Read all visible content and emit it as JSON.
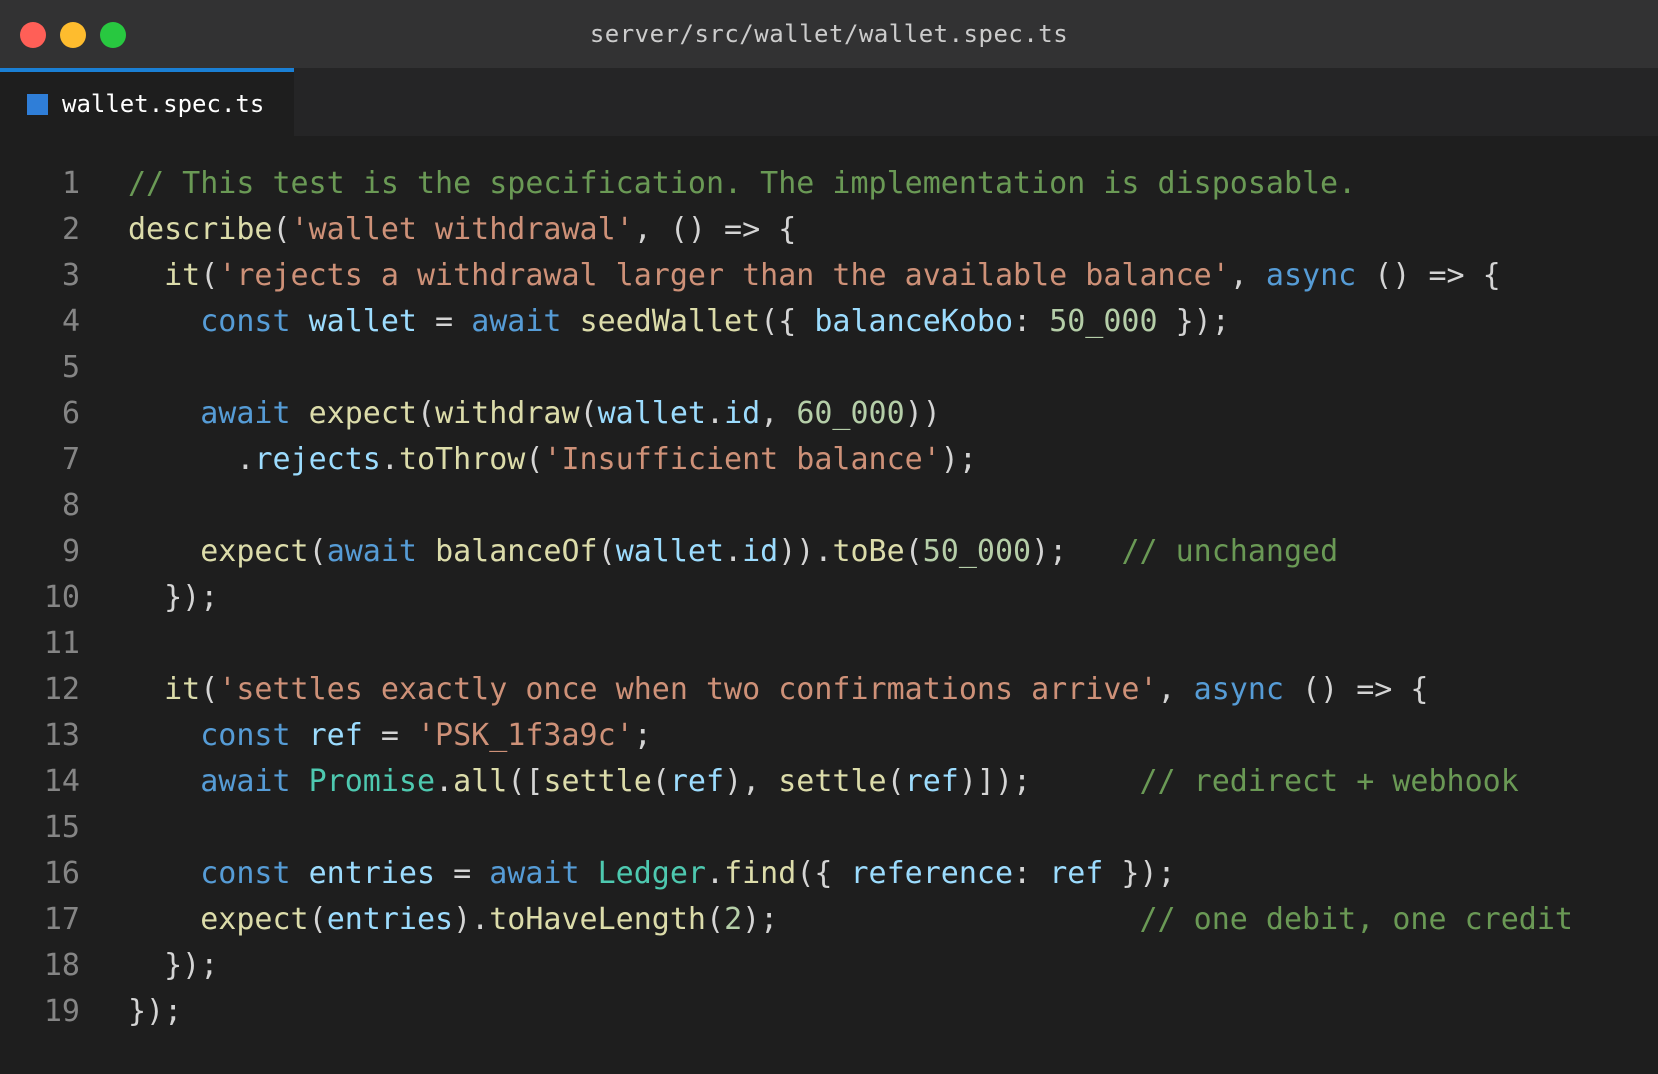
{
  "window": {
    "title": "server/src/wallet/wallet.spec.ts",
    "traffic_lights": [
      {
        "name": "close",
        "color": "#ff5f57"
      },
      {
        "name": "minimize",
        "color": "#febc2e"
      },
      {
        "name": "maximize",
        "color": "#28c840"
      }
    ]
  },
  "tabs": [
    {
      "label": "wallet.spec.ts",
      "icon": "typescript-file-icon",
      "active": true
    }
  ],
  "theme": {
    "comment": "#6a9955",
    "string": "#ce9178",
    "keyword": "#569cd6",
    "function": "#dcdcaa",
    "variable": "#9cdcfe",
    "number": "#b5cea8",
    "type": "#4ec9b0"
  },
  "code_lines": [
    {
      "n": "1",
      "tokens": [
        {
          "t": "// This test is the specification. The implementation is disposable.",
          "k": "comment"
        }
      ]
    },
    {
      "n": "2",
      "tokens": [
        {
          "t": "describe",
          "k": "func"
        },
        {
          "t": "(",
          "k": "punct"
        },
        {
          "t": "'wallet withdrawal'",
          "k": "string"
        },
        {
          "t": ", () => {",
          "k": "punct"
        }
      ]
    },
    {
      "n": "3",
      "tokens": [
        {
          "t": "  ",
          "k": "punct"
        },
        {
          "t": "it",
          "k": "func"
        },
        {
          "t": "(",
          "k": "punct"
        },
        {
          "t": "'rejects a withdrawal larger than the available balance'",
          "k": "string"
        },
        {
          "t": ", ",
          "k": "punct"
        },
        {
          "t": "async",
          "k": "keyword"
        },
        {
          "t": " () => {",
          "k": "punct"
        }
      ]
    },
    {
      "n": "4",
      "tokens": [
        {
          "t": "    ",
          "k": "punct"
        },
        {
          "t": "const",
          "k": "keyword"
        },
        {
          "t": " ",
          "k": "punct"
        },
        {
          "t": "wallet",
          "k": "var"
        },
        {
          "t": " = ",
          "k": "punct"
        },
        {
          "t": "await",
          "k": "keyword"
        },
        {
          "t": " ",
          "k": "punct"
        },
        {
          "t": "seedWallet",
          "k": "func"
        },
        {
          "t": "({ ",
          "k": "punct"
        },
        {
          "t": "balanceKobo",
          "k": "var"
        },
        {
          "t": ": ",
          "k": "punct"
        },
        {
          "t": "50_000",
          "k": "num"
        },
        {
          "t": " });",
          "k": "punct"
        }
      ]
    },
    {
      "n": "5",
      "tokens": []
    },
    {
      "n": "6",
      "tokens": [
        {
          "t": "    ",
          "k": "punct"
        },
        {
          "t": "await",
          "k": "keyword"
        },
        {
          "t": " ",
          "k": "punct"
        },
        {
          "t": "expect",
          "k": "func"
        },
        {
          "t": "(",
          "k": "punct"
        },
        {
          "t": "withdraw",
          "k": "func"
        },
        {
          "t": "(",
          "k": "punct"
        },
        {
          "t": "wallet",
          "k": "var"
        },
        {
          "t": ".",
          "k": "punct"
        },
        {
          "t": "id",
          "k": "var"
        },
        {
          "t": ", ",
          "k": "punct"
        },
        {
          "t": "60_000",
          "k": "num"
        },
        {
          "t": "))",
          "k": "punct"
        }
      ]
    },
    {
      "n": "7",
      "tokens": [
        {
          "t": "      .",
          "k": "punct"
        },
        {
          "t": "rejects",
          "k": "var"
        },
        {
          "t": ".",
          "k": "punct"
        },
        {
          "t": "toThrow",
          "k": "func"
        },
        {
          "t": "(",
          "k": "punct"
        },
        {
          "t": "'Insufficient balance'",
          "k": "string"
        },
        {
          "t": ");",
          "k": "punct"
        }
      ]
    },
    {
      "n": "8",
      "tokens": []
    },
    {
      "n": "9",
      "tokens": [
        {
          "t": "    ",
          "k": "punct"
        },
        {
          "t": "expect",
          "k": "func"
        },
        {
          "t": "(",
          "k": "punct"
        },
        {
          "t": "await",
          "k": "keyword"
        },
        {
          "t": " ",
          "k": "punct"
        },
        {
          "t": "balanceOf",
          "k": "func"
        },
        {
          "t": "(",
          "k": "punct"
        },
        {
          "t": "wallet",
          "k": "var"
        },
        {
          "t": ".",
          "k": "punct"
        },
        {
          "t": "id",
          "k": "var"
        },
        {
          "t": ")).",
          "k": "punct"
        },
        {
          "t": "toBe",
          "k": "func"
        },
        {
          "t": "(",
          "k": "punct"
        },
        {
          "t": "50_000",
          "k": "num"
        },
        {
          "t": ");   ",
          "k": "punct"
        },
        {
          "t": "// unchanged",
          "k": "comment"
        }
      ]
    },
    {
      "n": "10",
      "tokens": [
        {
          "t": "  });",
          "k": "punct"
        }
      ]
    },
    {
      "n": "11",
      "tokens": []
    },
    {
      "n": "12",
      "tokens": [
        {
          "t": "  ",
          "k": "punct"
        },
        {
          "t": "it",
          "k": "func"
        },
        {
          "t": "(",
          "k": "punct"
        },
        {
          "t": "'settles exactly once when two confirmations arrive'",
          "k": "string"
        },
        {
          "t": ", ",
          "k": "punct"
        },
        {
          "t": "async",
          "k": "keyword"
        },
        {
          "t": " () => {",
          "k": "punct"
        }
      ]
    },
    {
      "n": "13",
      "tokens": [
        {
          "t": "    ",
          "k": "punct"
        },
        {
          "t": "const",
          "k": "keyword"
        },
        {
          "t": " ",
          "k": "punct"
        },
        {
          "t": "ref",
          "k": "var"
        },
        {
          "t": " = ",
          "k": "punct"
        },
        {
          "t": "'PSK_1f3a9c'",
          "k": "string"
        },
        {
          "t": ";",
          "k": "punct"
        }
      ]
    },
    {
      "n": "14",
      "tokens": [
        {
          "t": "    ",
          "k": "punct"
        },
        {
          "t": "await",
          "k": "keyword"
        },
        {
          "t": " ",
          "k": "punct"
        },
        {
          "t": "Promise",
          "k": "type"
        },
        {
          "t": ".",
          "k": "punct"
        },
        {
          "t": "all",
          "k": "func"
        },
        {
          "t": "([",
          "k": "punct"
        },
        {
          "t": "settle",
          "k": "func"
        },
        {
          "t": "(",
          "k": "punct"
        },
        {
          "t": "ref",
          "k": "var"
        },
        {
          "t": "), ",
          "k": "punct"
        },
        {
          "t": "settle",
          "k": "func"
        },
        {
          "t": "(",
          "k": "punct"
        },
        {
          "t": "ref",
          "k": "var"
        },
        {
          "t": ")]);      ",
          "k": "punct"
        },
        {
          "t": "// redirect + webhook",
          "k": "comment"
        }
      ]
    },
    {
      "n": "15",
      "tokens": []
    },
    {
      "n": "16",
      "tokens": [
        {
          "t": "    ",
          "k": "punct"
        },
        {
          "t": "const",
          "k": "keyword"
        },
        {
          "t": " ",
          "k": "punct"
        },
        {
          "t": "entries",
          "k": "var"
        },
        {
          "t": " = ",
          "k": "punct"
        },
        {
          "t": "await",
          "k": "keyword"
        },
        {
          "t": " ",
          "k": "punct"
        },
        {
          "t": "Ledger",
          "k": "type"
        },
        {
          "t": ".",
          "k": "punct"
        },
        {
          "t": "find",
          "k": "func"
        },
        {
          "t": "({ ",
          "k": "punct"
        },
        {
          "t": "reference",
          "k": "var"
        },
        {
          "t": ": ",
          "k": "punct"
        },
        {
          "t": "ref",
          "k": "var"
        },
        {
          "t": " });",
          "k": "punct"
        }
      ]
    },
    {
      "n": "17",
      "tokens": [
        {
          "t": "    ",
          "k": "punct"
        },
        {
          "t": "expect",
          "k": "func"
        },
        {
          "t": "(",
          "k": "punct"
        },
        {
          "t": "entries",
          "k": "var"
        },
        {
          "t": ").",
          "k": "punct"
        },
        {
          "t": "toHaveLength",
          "k": "func"
        },
        {
          "t": "(",
          "k": "punct"
        },
        {
          "t": "2",
          "k": "num"
        },
        {
          "t": ");                    ",
          "k": "punct"
        },
        {
          "t": "// one debit, one credit",
          "k": "comment"
        }
      ]
    },
    {
      "n": "18",
      "tokens": [
        {
          "t": "  });",
          "k": "punct"
        }
      ]
    },
    {
      "n": "19",
      "tokens": [
        {
          "t": "});",
          "k": "punct"
        }
      ]
    }
  ]
}
